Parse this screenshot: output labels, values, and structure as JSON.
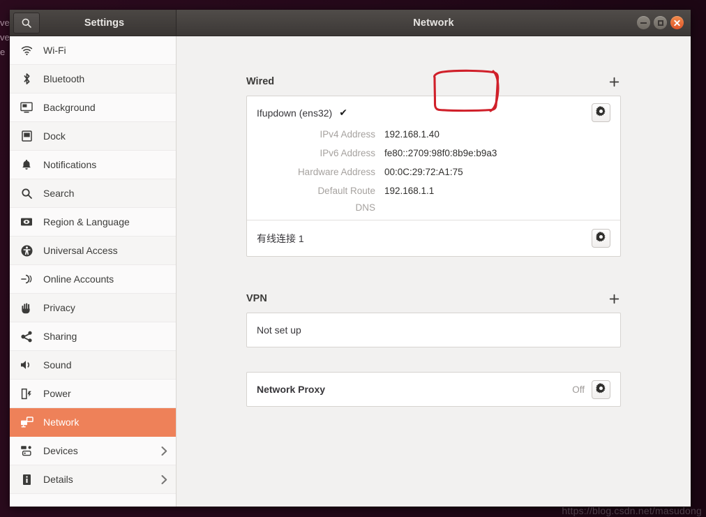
{
  "desktop": {
    "edge_text": "ve\nve\ne",
    "watermark": "https://blog.csdn.net/masudong"
  },
  "titlebar": {
    "settings_title": "Settings",
    "window_title": "Network",
    "search_icon": "search-icon",
    "minimize_label": "",
    "maximize_label": "",
    "close_label": ""
  },
  "sidebar": {
    "items": [
      {
        "label": "Wi-Fi",
        "icon": "wifi-icon",
        "selected": false,
        "chevron": false
      },
      {
        "label": "Bluetooth",
        "icon": "bluetooth-icon",
        "selected": false,
        "chevron": false
      },
      {
        "label": "Background",
        "icon": "background-icon",
        "selected": false,
        "chevron": false
      },
      {
        "label": "Dock",
        "icon": "dock-icon",
        "selected": false,
        "chevron": false
      },
      {
        "label": "Notifications",
        "icon": "bell-icon",
        "selected": false,
        "chevron": false
      },
      {
        "label": "Search",
        "icon": "search-icon",
        "selected": false,
        "chevron": false
      },
      {
        "label": "Region & Language",
        "icon": "region-language-icon",
        "selected": false,
        "chevron": false
      },
      {
        "label": "Universal Access",
        "icon": "accessibility-icon",
        "selected": false,
        "chevron": false
      },
      {
        "label": "Online Accounts",
        "icon": "online-accounts-icon",
        "selected": false,
        "chevron": false
      },
      {
        "label": "Privacy",
        "icon": "hand-icon",
        "selected": false,
        "chevron": false
      },
      {
        "label": "Sharing",
        "icon": "share-icon",
        "selected": false,
        "chevron": false
      },
      {
        "label": "Sound",
        "icon": "speaker-icon",
        "selected": false,
        "chevron": false
      },
      {
        "label": "Power",
        "icon": "battery-icon",
        "selected": false,
        "chevron": false
      },
      {
        "label": "Network",
        "icon": "network-icon",
        "selected": true,
        "chevron": false
      },
      {
        "label": "Devices",
        "icon": "devices-icon",
        "selected": false,
        "chevron": true
      },
      {
        "label": "Details",
        "icon": "info-icon",
        "selected": false,
        "chevron": true
      }
    ]
  },
  "main": {
    "wired": {
      "title": "Wired",
      "add_label": "+",
      "connection": {
        "name": "Ifupdown (ens32)",
        "connected_mark": "✔",
        "settings_icon": "gear-icon",
        "details": [
          {
            "key": "IPv4 Address",
            "value": "192.168.1.40"
          },
          {
            "key": "IPv6 Address",
            "value": "fe80::2709:98f0:8b9e:b9a3"
          },
          {
            "key": "Hardware Address",
            "value": "00:0C:29:72:A1:75"
          },
          {
            "key": "Default Route",
            "value": "192.168.1.1"
          },
          {
            "key": "DNS",
            "value": ""
          }
        ]
      },
      "second_connection": {
        "name": "有线连接 1",
        "settings_icon": "gear-icon"
      }
    },
    "vpn": {
      "title": "VPN",
      "add_label": "+",
      "status": "Not set up"
    },
    "proxy": {
      "title": "Network Proxy",
      "state": "Off",
      "settings_icon": "gear-icon"
    }
  },
  "annotation": {
    "shape": "hand-drawn-rectangle",
    "target": "Wired",
    "color": "#d0202a"
  },
  "colors": {
    "accent": "#ee8159",
    "titlebar": "#3c3836",
    "panel_bg": "#f2f1f0",
    "card_bg": "#ffffff",
    "annotation_red": "#d0202a"
  }
}
